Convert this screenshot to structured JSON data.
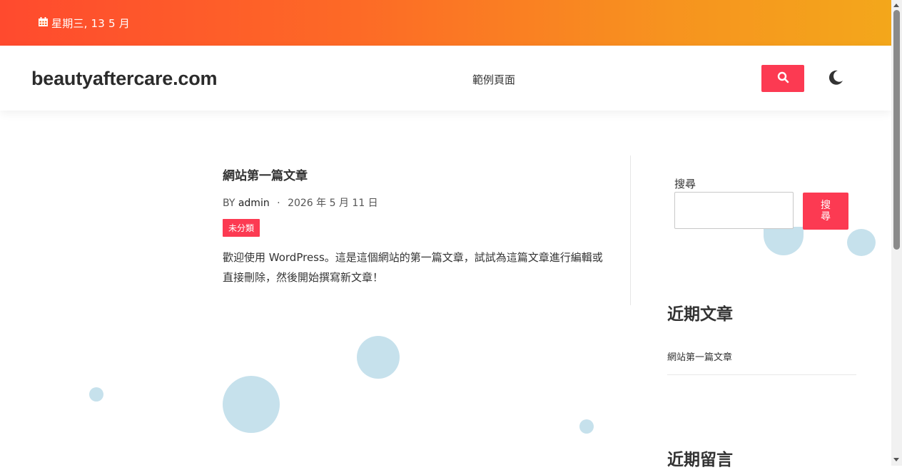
{
  "topbar": {
    "date_text": "星期三, 13 5 月",
    "icon": "calendar-icon"
  },
  "header": {
    "site_title": "beautyaftercare.com",
    "nav_items": [
      "範例頁面"
    ],
    "search_icon": "search-icon",
    "theme_icon": "moon-icon"
  },
  "post": {
    "title": "網站第一篇文章",
    "by_label": "BY",
    "author": "admin",
    "separator": "·",
    "date": "2026 年 5 月 11 日",
    "category": "未分類",
    "excerpt": "歡迎使用 WordPress。這是這個網站的第一篇文章，試試為這篇文章進行編輯或直接刪除，然後開始撰寫新文章！"
  },
  "sidebar": {
    "search_label": "搜尋",
    "search_value": "",
    "search_button": "搜尋",
    "recent_posts_title": "近期文章",
    "recent_posts": [
      "網站第一篇文章"
    ],
    "recent_comments_title": "近期留言"
  },
  "colors": {
    "accent": "#fc3a52",
    "gradient_start": "#ff4a2e",
    "gradient_end": "#f3a71b",
    "bubble": "#c6e1ec"
  }
}
